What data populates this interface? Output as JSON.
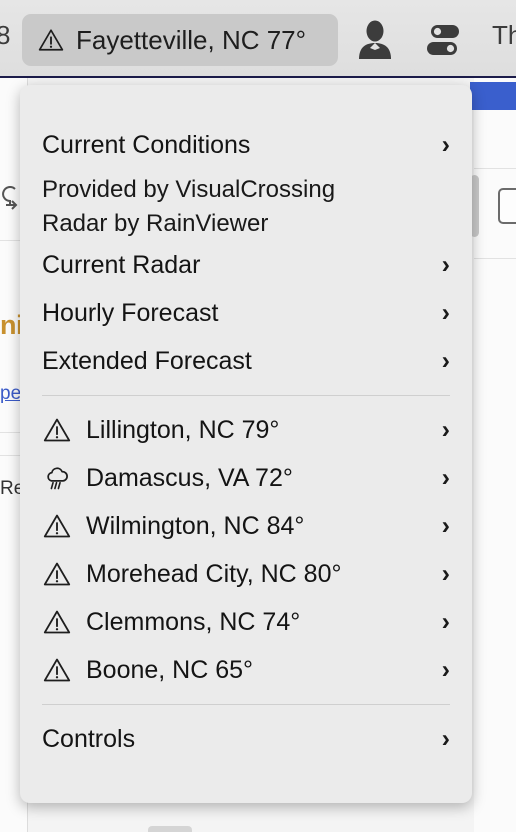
{
  "toolbar": {
    "partial_left_text": "8",
    "location_pill": {
      "icon": "warning-triangle-icon",
      "label": "Fayetteville, NC 77°"
    },
    "person_icon": "person-icon",
    "sliders_icon": "sliders-toggle-icon",
    "partial_right_text": "Th"
  },
  "menu": {
    "current_conditions": {
      "label": "Current Conditions",
      "chevron": "›"
    },
    "provider_lines": [
      "Provided by VisualCrossing",
      "Radar by RainViewer"
    ],
    "nav_items": [
      {
        "label": "Current Radar",
        "chevron": "›"
      },
      {
        "label": "Hourly Forecast",
        "chevron": "›"
      },
      {
        "label": "Extended Forecast",
        "chevron": "›"
      }
    ],
    "locations": [
      {
        "icon": "warning-triangle-icon",
        "label": "Lillington, NC 79°",
        "chevron": "›"
      },
      {
        "icon": "rain-cloud-icon",
        "label": "Damascus, VA 72°",
        "chevron": "›"
      },
      {
        "icon": "warning-triangle-icon",
        "label": "Wilmington, NC 84°",
        "chevron": "›"
      },
      {
        "icon": "warning-triangle-icon",
        "label": "Morehead City, NC 80°",
        "chevron": "›"
      },
      {
        "icon": "warning-triangle-icon",
        "label": "Clemmons, NC 74°",
        "chevron": "›"
      },
      {
        "icon": "warning-triangle-icon",
        "label": "Boone, NC 65°",
        "chevron": "›"
      }
    ],
    "controls": {
      "label": "Controls",
      "chevron": "›"
    }
  },
  "background": {
    "orange_text": "ni",
    "link_text": "pe",
    "re_text": "Re",
    "reply_icon": "reply-arrow-icon",
    "accent_blue": "#3a5fcd",
    "accent_orange": "#c8912f",
    "link_blue": "#3b5bc8"
  }
}
